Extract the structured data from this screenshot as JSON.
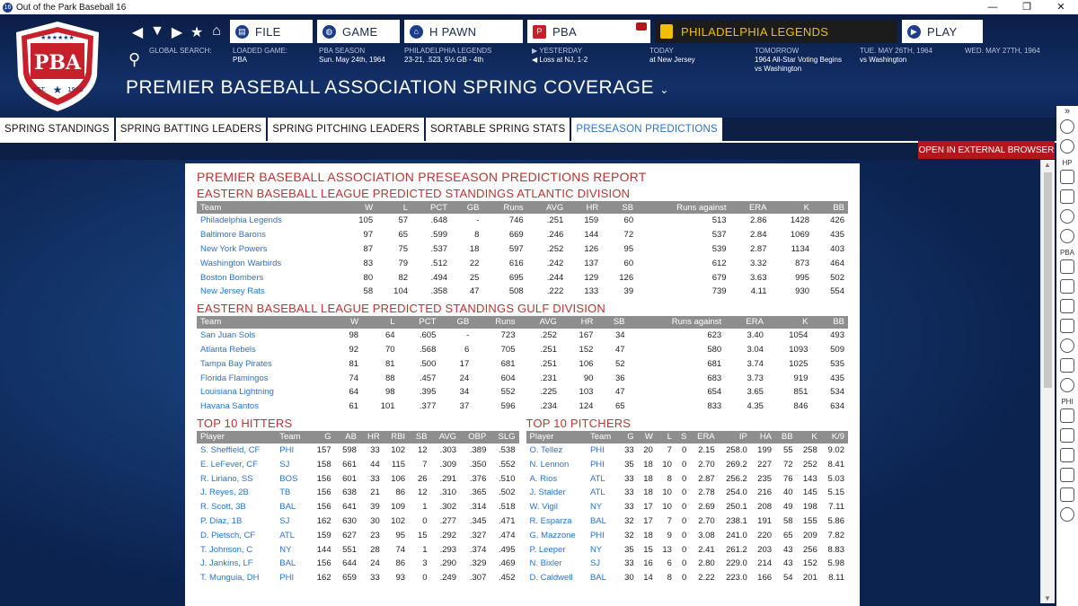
{
  "window": {
    "title": "Out of the Park Baseball 16",
    "app_icon": "16"
  },
  "header": {
    "logo_text": "PBA",
    "logo_est": "EST.",
    "logo_year": "1950",
    "menu": [
      {
        "label": "FILE",
        "icon": "file-icon"
      },
      {
        "label": "GAME",
        "icon": "globe-icon"
      },
      {
        "label": "H PAWN",
        "icon": "home-icon"
      },
      {
        "label": "PBA",
        "icon": "pba-icon"
      }
    ],
    "team_button": "PHILADELPHIA LEGENDS",
    "play_button": "PLAY",
    "info": {
      "search_label": "GLOBAL SEARCH:",
      "loaded_label": "LOADED GAME:",
      "loaded_value": "PBA",
      "season_label": "PBA SEASON",
      "season_value": "Sun. May 24th, 1964",
      "team_label": "PHILADELPHIA LEGENDS",
      "team_value": "23-21, .523, 5½ GB - 4th",
      "yesterday_label": "YESTERDAY",
      "yesterday_value": "Loss at NJ, 1-2",
      "today_label": "TODAY",
      "today_value": "at New Jersey",
      "tomorrow_label": "TOMORROW",
      "tomorrow_value1": "1964 All-Star Voting Begins",
      "tomorrow_value2": "vs Washington",
      "tue_label": "TUE. MAY 26TH, 1964",
      "tue_value": "vs Washington",
      "wed_label": "WED. MAY 27TH, 1964"
    },
    "page_title": "PREMIER BASEBALL ASSOCIATION SPRING COVERAGE"
  },
  "tabs": [
    "SPRING STANDINGS",
    "SPRING BATTING LEADERS",
    "SPRING PITCHING LEADERS",
    "SORTABLE SPRING STATS",
    "PRESEASON PREDICTIONS"
  ],
  "external_button": "OPEN IN EXTERNAL BROWSER",
  "sidebar_labels": {
    "hp": "HP",
    "pba": "PBA",
    "phi": "PHI"
  },
  "report": {
    "title": "PREMIER BASEBALL ASSOCIATION PRESEASON PREDICTIONS REPORT",
    "standings_headers": [
      "Team",
      "W",
      "L",
      "PCT",
      "GB",
      "Runs",
      "AVG",
      "HR",
      "SB",
      "Runs against",
      "ERA",
      "K",
      "BB"
    ],
    "atlantic": {
      "title": "EASTERN BASEBALL LEAGUE PREDICTED STANDINGS ATLANTIC DIVISION",
      "rows": [
        [
          "Philadelphia Legends",
          "105",
          "57",
          ".648",
          "-",
          "746",
          ".251",
          "159",
          "60",
          "513",
          "2.86",
          "1428",
          "426"
        ],
        [
          "Baltimore Barons",
          "97",
          "65",
          ".599",
          "8",
          "669",
          ".246",
          "144",
          "72",
          "537",
          "2.84",
          "1069",
          "435"
        ],
        [
          "New York Powers",
          "87",
          "75",
          ".537",
          "18",
          "597",
          ".252",
          "126",
          "95",
          "539",
          "2.87",
          "1134",
          "403"
        ],
        [
          "Washington Warbirds",
          "83",
          "79",
          ".512",
          "22",
          "616",
          ".242",
          "137",
          "60",
          "612",
          "3.32",
          "873",
          "464"
        ],
        [
          "Boston Bombers",
          "80",
          "82",
          ".494",
          "25",
          "695",
          ".244",
          "129",
          "126",
          "679",
          "3.63",
          "995",
          "502"
        ],
        [
          "New Jersey Rats",
          "58",
          "104",
          ".358",
          "47",
          "508",
          ".222",
          "133",
          "39",
          "739",
          "4.11",
          "930",
          "554"
        ]
      ]
    },
    "gulf": {
      "title": "EASTERN BASEBALL LEAGUE PREDICTED STANDINGS GULF DIVISION",
      "rows": [
        [
          "San Juan Sols",
          "98",
          "64",
          ".605",
          "-",
          "723",
          ".252",
          "167",
          "34",
          "623",
          "3.40",
          "1054",
          "493"
        ],
        [
          "Atlanta Rebels",
          "92",
          "70",
          ".568",
          "6",
          "705",
          ".251",
          "152",
          "47",
          "580",
          "3.04",
          "1093",
          "509"
        ],
        [
          "Tampa Bay Pirates",
          "81",
          "81",
          ".500",
          "17",
          "681",
          ".251",
          "106",
          "52",
          "681",
          "3.74",
          "1025",
          "535"
        ],
        [
          "Florida Flamingos",
          "74",
          "88",
          ".457",
          "24",
          "604",
          ".231",
          "90",
          "36",
          "683",
          "3.73",
          "919",
          "435"
        ],
        [
          "Louisiana Lightning",
          "64",
          "98",
          ".395",
          "34",
          "552",
          ".225",
          "103",
          "47",
          "654",
          "3.65",
          "851",
          "534"
        ],
        [
          "Havana Santos",
          "61",
          "101",
          ".377",
          "37",
          "596",
          ".234",
          "124",
          "65",
          "833",
          "4.35",
          "846",
          "634"
        ]
      ]
    },
    "hitters": {
      "title": "TOP 10 HITTERS",
      "headers": [
        "Player",
        "Team",
        "G",
        "AB",
        "HR",
        "RBI",
        "SB",
        "AVG",
        "OBP",
        "SLG"
      ],
      "rows": [
        [
          "S. Sheffield, CF",
          "PHI",
          "157",
          "598",
          "33",
          "102",
          "12",
          ".303",
          ".389",
          ".538"
        ],
        [
          "E. LeFever, CF",
          "SJ",
          "158",
          "661",
          "44",
          "115",
          "7",
          ".309",
          ".350",
          ".552"
        ],
        [
          "R. Liriano, SS",
          "BOS",
          "156",
          "601",
          "33",
          "106",
          "26",
          ".291",
          ".376",
          ".510"
        ],
        [
          "J. Reyes, 2B",
          "TB",
          "156",
          "638",
          "21",
          "86",
          "12",
          ".310",
          ".365",
          ".502"
        ],
        [
          "R. Scott, 3B",
          "BAL",
          "156",
          "641",
          "39",
          "109",
          "1",
          ".302",
          ".314",
          ".518"
        ],
        [
          "P. Diaz, 1B",
          "SJ",
          "162",
          "630",
          "30",
          "102",
          "0",
          ".277",
          ".345",
          ".471"
        ],
        [
          "D. Pietsch, CF",
          "ATL",
          "159",
          "627",
          "23",
          "95",
          "15",
          ".292",
          ".327",
          ".474"
        ],
        [
          "T. Johnson, C",
          "NY",
          "144",
          "551",
          "28",
          "74",
          "1",
          ".293",
          ".374",
          ".495"
        ],
        [
          "J. Jankins, LF",
          "BAL",
          "156",
          "644",
          "24",
          "86",
          "3",
          ".290",
          ".329",
          ".469"
        ],
        [
          "T. Munguia, DH",
          "PHI",
          "162",
          "659",
          "33",
          "93",
          "0",
          ".249",
          ".307",
          ".452"
        ]
      ]
    },
    "pitchers": {
      "title": "TOP 10 PITCHERS",
      "headers": [
        "Player",
        "Team",
        "G",
        "W",
        "L",
        "S",
        "ERA",
        "IP",
        "HA",
        "BB",
        "K",
        "K/9"
      ],
      "rows": [
        [
          "O. Tellez",
          "PHI",
          "33",
          "20",
          "7",
          "0",
          "2.15",
          "258.0",
          "199",
          "55",
          "258",
          "9.02"
        ],
        [
          "N. Lennon",
          "PHI",
          "35",
          "18",
          "10",
          "0",
          "2.70",
          "269.2",
          "227",
          "72",
          "252",
          "8.41"
        ],
        [
          "A. Rios",
          "ATL",
          "33",
          "18",
          "8",
          "0",
          "2.87",
          "256.2",
          "235",
          "76",
          "143",
          "5.03"
        ],
        [
          "J. Stalder",
          "ATL",
          "33",
          "18",
          "10",
          "0",
          "2.78",
          "254.0",
          "216",
          "40",
          "145",
          "5.15"
        ],
        [
          "W. Vigil",
          "NY",
          "33",
          "17",
          "10",
          "0",
          "2.69",
          "250.1",
          "208",
          "49",
          "198",
          "7.11"
        ],
        [
          "R. Esparza",
          "BAL",
          "32",
          "17",
          "7",
          "0",
          "2.70",
          "238.1",
          "191",
          "58",
          "155",
          "5.86"
        ],
        [
          "G. Mazzone",
          "PHI",
          "32",
          "18",
          "9",
          "0",
          "3.08",
          "241.0",
          "220",
          "65",
          "209",
          "7.82"
        ],
        [
          "P. Leeper",
          "NY",
          "35",
          "15",
          "13",
          "0",
          "2.41",
          "261.2",
          "203",
          "43",
          "256",
          "8.83"
        ],
        [
          "N. Bixler",
          "SJ",
          "33",
          "16",
          "6",
          "0",
          "2.80",
          "229.0",
          "214",
          "43",
          "152",
          "5.98"
        ],
        [
          "D. Caldwell",
          "BAL",
          "30",
          "14",
          "8",
          "0",
          "2.22",
          "223.0",
          "166",
          "54",
          "201",
          "8.11"
        ]
      ]
    }
  },
  "colors": {
    "accent_red": "#b33333",
    "link_blue": "#2a73c9",
    "header_navy": "#123068",
    "team_gold": "#f0c000",
    "button_red": "#b2171c"
  }
}
